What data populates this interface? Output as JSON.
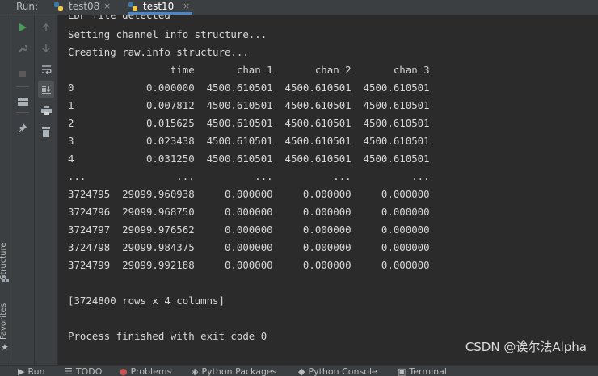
{
  "run_bar": {
    "label": "Run:",
    "tabs": [
      {
        "name": "test08",
        "close": "×"
      },
      {
        "name": "test10",
        "close": "×"
      }
    ]
  },
  "side_labels": {
    "structure": "Structure",
    "favorites": "Favorites"
  },
  "tool_icons": {
    "rerun": "play-icon",
    "wrench": "wrench-icon",
    "stop": "stop-icon",
    "layout": "layout-icon",
    "pin": "pin-icon",
    "up": "arrow-up-icon",
    "down": "arrow-down-icon",
    "wrap": "soft-wrap-icon",
    "scroll_end": "scroll-to-end-icon",
    "print": "print-icon",
    "trash": "trash-icon"
  },
  "console_lines": [
    "EDF file detected",
    "Setting channel info structure...",
    "Creating raw.info structure...",
    "                 time       chan 1       chan 2       chan 3",
    "0            0.000000  4500.610501  4500.610501  4500.610501",
    "1            0.007812  4500.610501  4500.610501  4500.610501",
    "2            0.015625  4500.610501  4500.610501  4500.610501",
    "3            0.023438  4500.610501  4500.610501  4500.610501",
    "4            0.031250  4500.610501  4500.610501  4500.610501",
    "...               ...          ...          ...          ...",
    "3724795  29099.960938     0.000000     0.000000     0.000000",
    "3724796  29099.968750     0.000000     0.000000     0.000000",
    "3724797  29099.976562     0.000000     0.000000     0.000000",
    "3724798  29099.984375     0.000000     0.000000     0.000000",
    "3724799  29099.992188     0.000000     0.000000     0.000000",
    "",
    "[3724800 rows x 4 columns]",
    "",
    "Process finished with exit code 0"
  ],
  "watermark": "CSDN @诶尔法Alpha",
  "bottom_tabs": [
    {
      "icon": "play-icon",
      "label": "Run"
    },
    {
      "icon": "todo-icon",
      "label": "TODO"
    },
    {
      "icon": "problems-icon",
      "label": "Problems"
    },
    {
      "icon": "python-packages-icon",
      "label": "Python Packages"
    },
    {
      "icon": "python-console-icon",
      "label": "Python Console"
    },
    {
      "icon": "terminal-icon",
      "label": "Terminal"
    }
  ],
  "colors": {
    "accent": "#4a88c7",
    "run_green": "#499c54",
    "bg": "#2b2b2b",
    "panel": "#3c3f41"
  }
}
